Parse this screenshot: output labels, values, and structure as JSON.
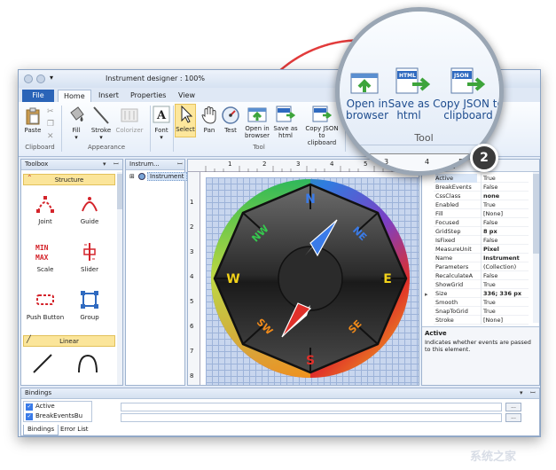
{
  "window": {
    "title": "Instrument designer : 100%"
  },
  "tabs": {
    "file": "File",
    "home": "Home",
    "insert": "Insert",
    "properties": "Properties",
    "view": "View"
  },
  "ribbon": {
    "paste": "Paste",
    "fill": "Fill",
    "stroke": "Stroke",
    "colorizer": "Colorizer",
    "font": "Font",
    "select": "Select",
    "pan": "Pan",
    "test": "Test",
    "open_l1": "Open in",
    "open_l2": "browser",
    "save_l1": "Save as",
    "save_l2": "html",
    "copy_l1": "Copy JSON to",
    "copy_l2": "clipboard",
    "group_clipboard": "Clipboard",
    "group_appearance": "Appearance",
    "group_tool": "Tool",
    "html_badge": "HTML",
    "json_badge": "JSON"
  },
  "toolbox": {
    "title": "Toolbox",
    "section_structure": "Structure",
    "section_linear": "Linear",
    "items": {
      "joint": "Joint",
      "guide": "Guide",
      "scale": "Scale",
      "slider": "Slider",
      "push_button": "Push Button",
      "group": "Group"
    },
    "scale_icon_text1": "MIN",
    "scale_icon_text2": "MAX"
  },
  "tree": {
    "title": "Instrum...",
    "root": "Instrument"
  },
  "ruler": {
    "top": [
      "1",
      "2",
      "3",
      "4",
      "5"
    ],
    "left": [
      "1",
      "2",
      "3",
      "4",
      "5",
      "6",
      "7",
      "8"
    ]
  },
  "compass": {
    "n": "N",
    "ne": "NE",
    "e": "E",
    "se": "SE",
    "s": "S",
    "sw": "SW",
    "w": "W",
    "nw": "NW"
  },
  "properties": {
    "rows": [
      {
        "name": "Active",
        "value": "True"
      },
      {
        "name": "BreakEvents",
        "value": "False"
      },
      {
        "name": "CssClass",
        "value": "none"
      },
      {
        "name": "Enabled",
        "value": "True"
      },
      {
        "name": "Fill",
        "value": "[None]"
      },
      {
        "name": "Focused",
        "value": "False"
      },
      {
        "name": "GridStep",
        "value": "8 px"
      },
      {
        "name": "IsFixed",
        "value": "False"
      },
      {
        "name": "MeasureUnit",
        "value": "Pixel"
      },
      {
        "name": "Name",
        "value": "Instrument"
      },
      {
        "name": "Parameters",
        "value": "(Collection)"
      },
      {
        "name": "RecalculateA",
        "value": "False"
      },
      {
        "name": "ShowGrid",
        "value": "True"
      },
      {
        "name": "Size",
        "value": "336; 336 px"
      },
      {
        "name": "Smooth",
        "value": "True"
      },
      {
        "name": "SnapToGrid",
        "value": "True"
      },
      {
        "name": "Stroke",
        "value": "[None]"
      }
    ],
    "desc_title": "Active",
    "desc_text": "Indicates whether events are passed to this element."
  },
  "bindings": {
    "title": "Bindings",
    "items": [
      "Active",
      "BreakEventsBu"
    ],
    "btn": "...",
    "tab1": "Bindings",
    "tab2": "Error List"
  },
  "zoom": {
    "open_l1": "Open in",
    "open_l2": "browser",
    "save_l1": "Save as",
    "save_l2": "html",
    "copy_l1": "Copy JSON to",
    "copy_l2": "clipboard",
    "group": "Tool",
    "ruler": [
      "3",
      "4",
      "5"
    ]
  },
  "callout": {
    "number": "2"
  },
  "watermark": "系统之家"
}
